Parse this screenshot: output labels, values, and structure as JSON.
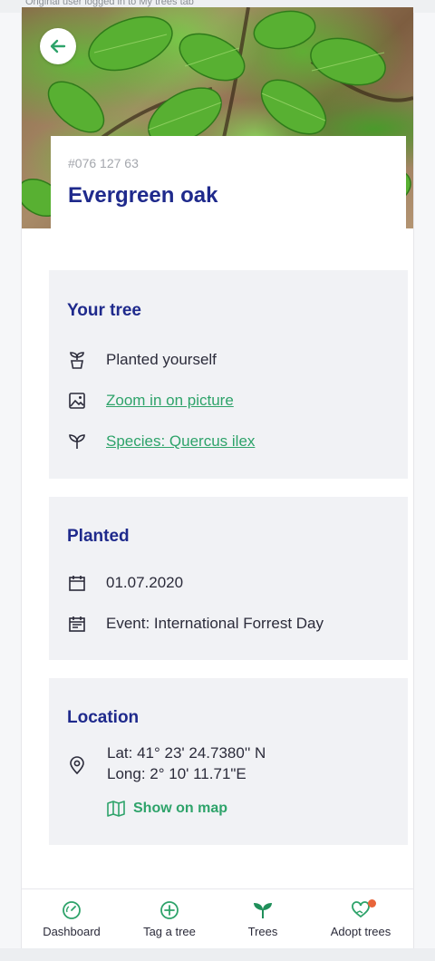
{
  "status": {
    "text": "Original user logged in to My trees tab"
  },
  "hero": {
    "image_alt": "Oak leaves photo"
  },
  "header": {
    "back_icon": "arrow-left-icon"
  },
  "tree": {
    "id": "#076 127 63",
    "name": "Evergreen oak"
  },
  "your_tree": {
    "title": "Your tree",
    "planted_by": "Planted yourself",
    "zoom_link": "Zoom in on picture",
    "species_link": "Species: Quercus ilex"
  },
  "planted": {
    "title": "Planted",
    "date": "01.07.2020",
    "event": "Event: International Forrest Day"
  },
  "location": {
    "title": "Location",
    "lat": "Lat: 41° 23' 24.7380'' N",
    "long": "Long:  2° 10' 11.71\"E",
    "map_link": "Show on map"
  },
  "nav": {
    "items": [
      {
        "label": "Dashboard",
        "icon": "gauge-icon"
      },
      {
        "label": "Tag a tree",
        "icon": "plus-circle-icon"
      },
      {
        "label": "Trees",
        "icon": "sprout-icon"
      },
      {
        "label": "Adopt trees",
        "icon": "heart-hands-icon"
      }
    ]
  },
  "colors": {
    "accent_blue": "#1f2a8c",
    "accent_green": "#2ea36a",
    "card_bg": "#f1f2f5",
    "badge": "#e8643a"
  }
}
